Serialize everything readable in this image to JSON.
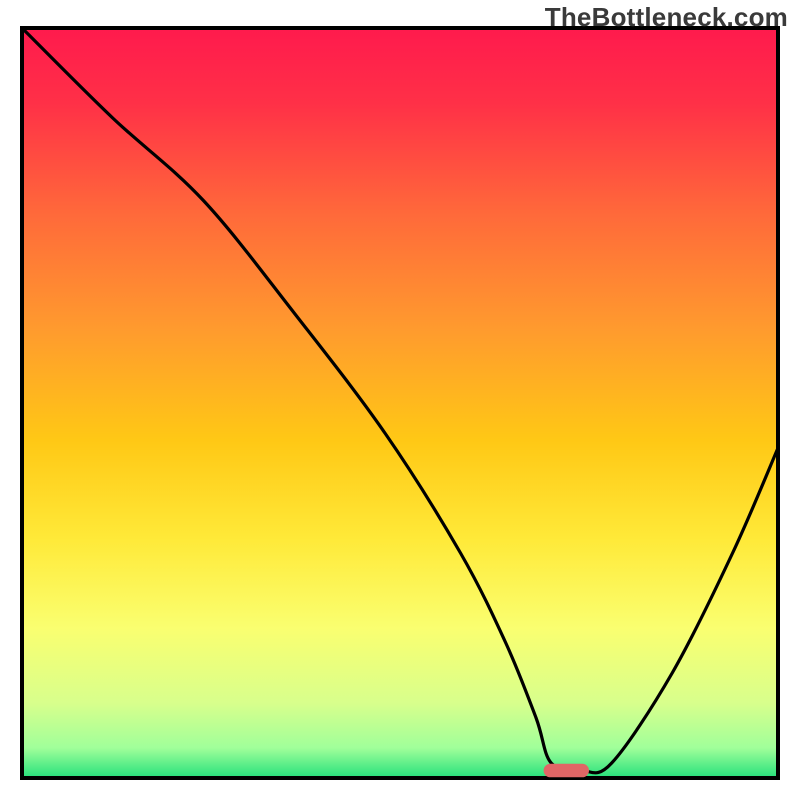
{
  "watermark": "TheBottleneck.com",
  "chart_data": {
    "type": "line",
    "title": "",
    "xlabel": "",
    "ylabel": "",
    "xlim": [
      0,
      100
    ],
    "ylim": [
      0,
      100
    ],
    "x": [
      0,
      12,
      24,
      36,
      48,
      58,
      64,
      68,
      70,
      74,
      78,
      86,
      94,
      100
    ],
    "values": [
      100,
      88,
      77,
      62,
      46,
      30,
      18,
      8,
      2,
      1,
      2,
      14,
      30,
      44
    ],
    "flat_segment": {
      "x0": 70,
      "x1": 74,
      "y": 1
    },
    "marker": {
      "x": 72,
      "y": 1,
      "color": "#e06666",
      "width_pct": 6,
      "height_pct": 1.8
    },
    "gradient_stops": [
      {
        "offset": 0.0,
        "color": "#ff1a4d"
      },
      {
        "offset": 0.1,
        "color": "#ff3047"
      },
      {
        "offset": 0.25,
        "color": "#ff6a3a"
      },
      {
        "offset": 0.4,
        "color": "#ff9a2e"
      },
      {
        "offset": 0.55,
        "color": "#ffc815"
      },
      {
        "offset": 0.68,
        "color": "#ffe938"
      },
      {
        "offset": 0.8,
        "color": "#faff70"
      },
      {
        "offset": 0.9,
        "color": "#d8ff8c"
      },
      {
        "offset": 0.96,
        "color": "#a0ff9a"
      },
      {
        "offset": 1.0,
        "color": "#25e07c"
      }
    ]
  }
}
